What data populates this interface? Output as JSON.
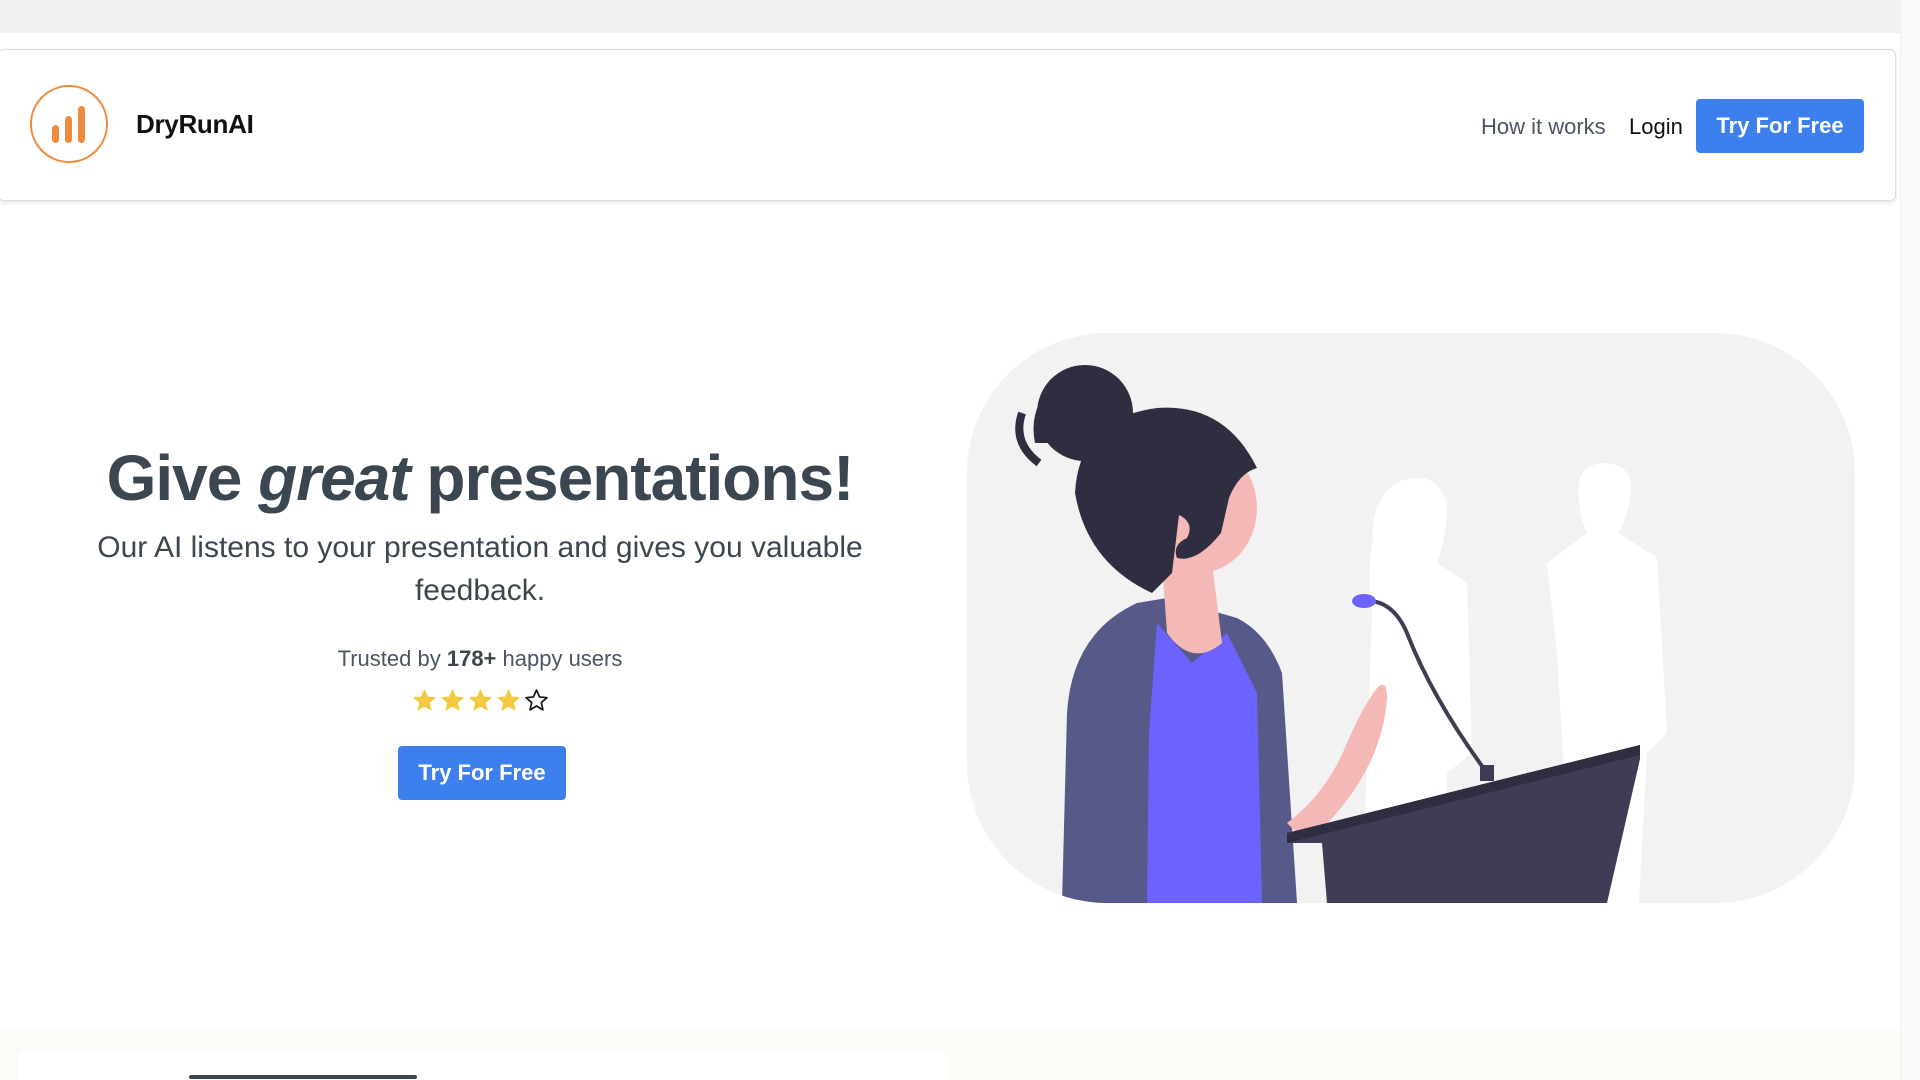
{
  "brand": {
    "name": "DryRunAI",
    "logo_icon": "bar-chart-circle-icon",
    "accent_color": "#ee8b3e"
  },
  "nav": {
    "how_it_works": "How it works",
    "login": "Login",
    "cta": "Try For Free",
    "cta_color": "#3d7fec"
  },
  "hero": {
    "headline_start": "Give ",
    "headline_emph": "great",
    "headline_end": " presentations!",
    "subheadline": "Our AI listens to your presentation and gives you valuable feedback.",
    "trusted_prefix": "Trusted by ",
    "trusted_count": "178+",
    "trusted_suffix": " happy users",
    "rating": {
      "value": 4,
      "max": 5,
      "filled_color": "#f5c842"
    },
    "cta": "Try For Free"
  },
  "illustration": {
    "icon": "woman-presenting-at-podium-illustration"
  }
}
